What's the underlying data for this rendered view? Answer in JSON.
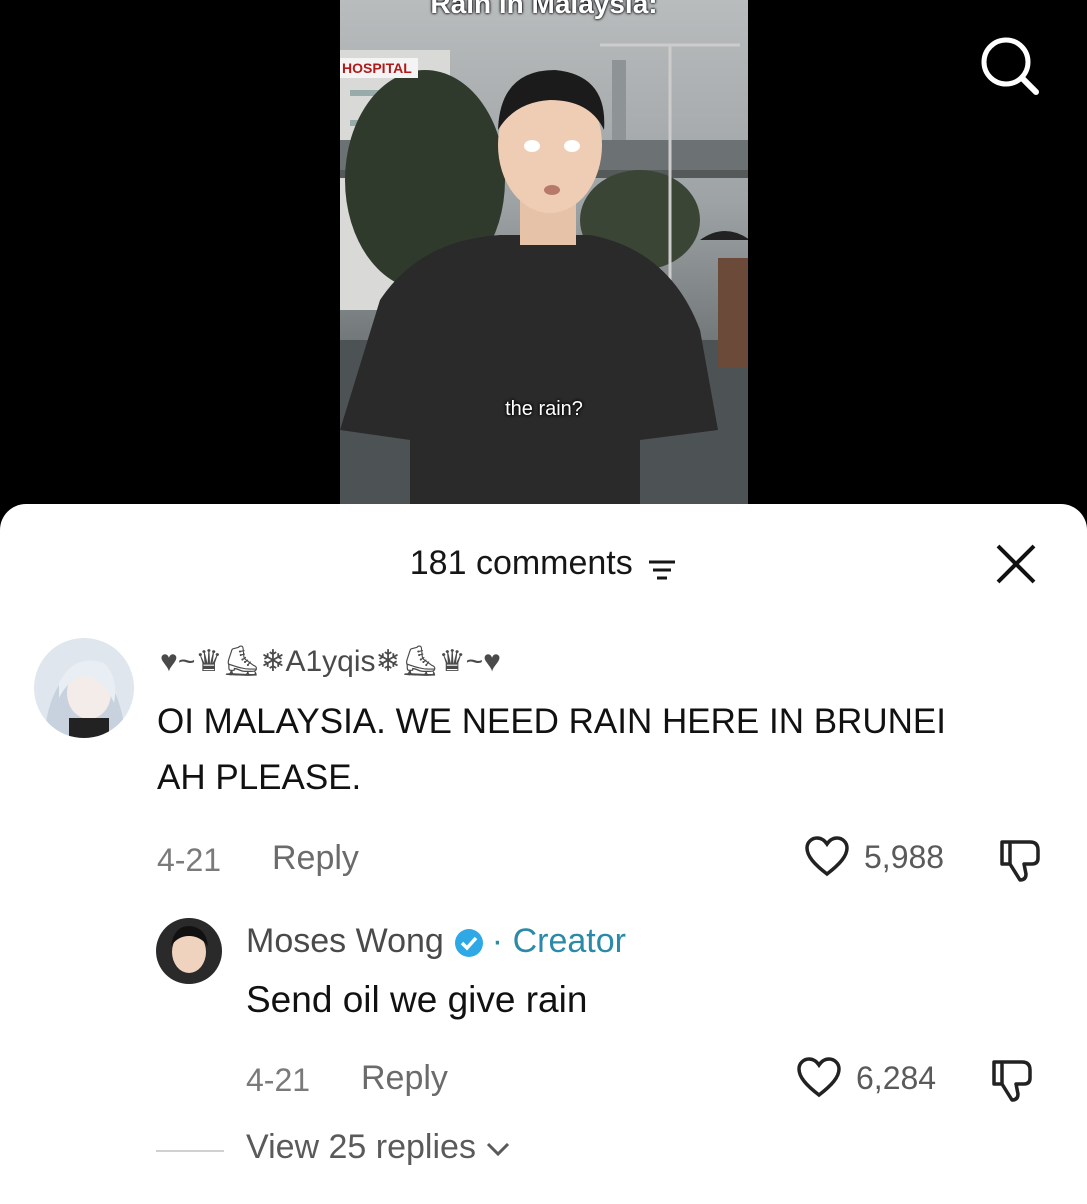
{
  "video": {
    "title": "Rain in Malaysia:",
    "sign_text": "HOSPITAL",
    "subtitle": "the rain?"
  },
  "sheet": {
    "comment_count": "181 comments"
  },
  "comments": [
    {
      "username": "♥~♛⛸❄A1yqis❄⛸♛~♥",
      "text": "OI MALAYSIA. WE NEED RAIN HERE IN BRUNEI AH PLEASE.",
      "date": "4-21",
      "reply_label": "Reply",
      "likes": "5,988"
    }
  ],
  "reply": {
    "username": "Moses Wong",
    "creator_label": "· Creator",
    "text": "Send oil we give rain",
    "date": "4-21",
    "reply_label": "Reply",
    "likes": "6,284"
  },
  "view_replies": "View 25 replies",
  "colors": {
    "creator": "#2a8aa8",
    "verified": "#2ea9e6"
  }
}
